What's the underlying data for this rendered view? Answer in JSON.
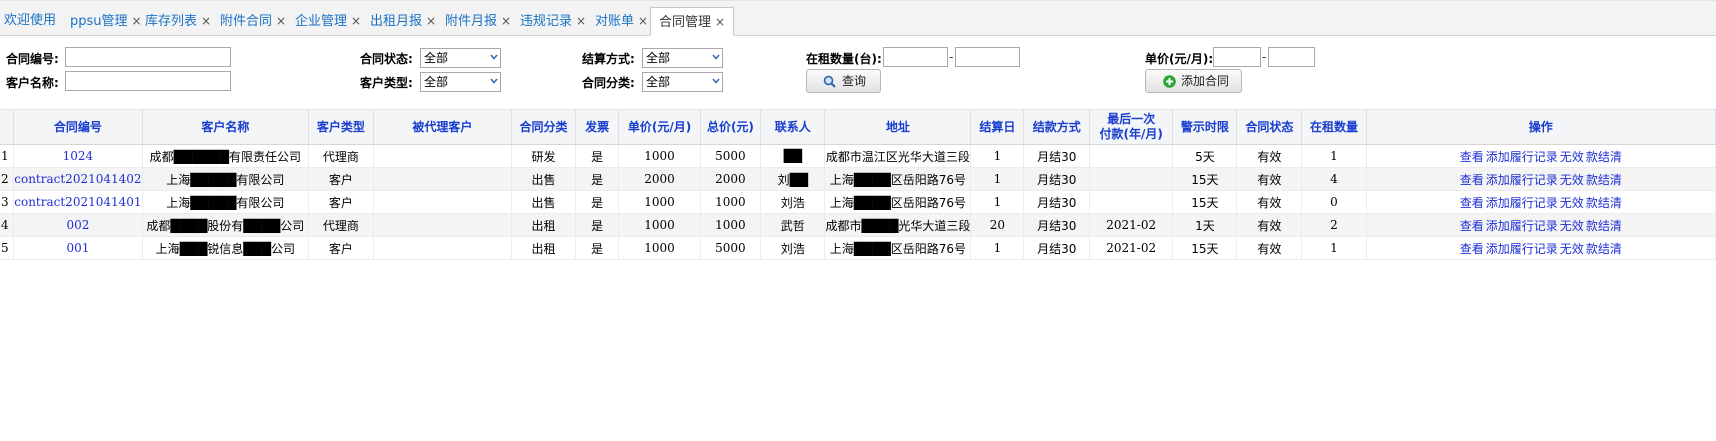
{
  "tabs": [
    {
      "label": "欢迎使用",
      "closable": false
    },
    {
      "label": "ppsu管理",
      "closable": true
    },
    {
      "label": "库存列表",
      "closable": true
    },
    {
      "label": "附件合同",
      "closable": true
    },
    {
      "label": "企业管理",
      "closable": true
    },
    {
      "label": "出租月报",
      "closable": true
    },
    {
      "label": "附件月报",
      "closable": true
    },
    {
      "label": "违规记录",
      "closable": true
    },
    {
      "label": "对账单",
      "closable": true
    },
    {
      "label": "合同管理",
      "closable": true,
      "active": true
    }
  ],
  "close_glyph": "×",
  "filters": {
    "contract_no_label": "合同编号:",
    "customer_name_label": "客户名称:",
    "contract_status_label": "合同状态:",
    "contract_status_value": "全部",
    "customer_type_label": "客户类型:",
    "customer_type_value": "全部",
    "settle_method_label": "结算方式:",
    "settle_method_value": "全部",
    "contract_category_label": "合同分类:",
    "contract_category_value": "全部",
    "rent_qty_label": "在租数量(台):",
    "unit_price_label": "单价(元/月):",
    "range_sep": "-",
    "query_button": "查询",
    "add_contract_button": "添加合同"
  },
  "table": {
    "headers": [
      "合同编号",
      "客户名称",
      "客户类型",
      "被代理客户",
      "合同分类",
      "发票",
      "单价(元/月)",
      "总价(元)",
      "联系人",
      "地址",
      "结算日",
      "结款方式",
      "最后一次\n付款(年/月)",
      "警示时限",
      "合同状态",
      "在租数量",
      "操作"
    ],
    "rows": [
      {
        "index": "1",
        "no": "1024",
        "customer": "成都██████有限责任公司",
        "type": "代理商",
        "proxy": "",
        "category": "研发",
        "invoice": "是",
        "unit": "1000",
        "total": "5000",
        "contact": "██",
        "address": "成都市温江区光华大道三段",
        "day": "1",
        "settle": "月结30",
        "last_pay": "",
        "warn": "5天",
        "status": "有效",
        "qty": "1"
      },
      {
        "index": "2",
        "no": "contract2021041402",
        "customer": "上海█████有限公司",
        "type": "客户",
        "proxy": "",
        "category": "出售",
        "invoice": "是",
        "unit": "2000",
        "total": "2000",
        "contact": "刘██",
        "address": "上海████区岳阳路76号",
        "day": "1",
        "settle": "月结30",
        "last_pay": "",
        "warn": "15天",
        "status": "有效",
        "qty": "4"
      },
      {
        "index": "3",
        "no": "contract2021041401",
        "customer": "上海█████有限公司",
        "type": "客户",
        "proxy": "",
        "category": "出售",
        "invoice": "是",
        "unit": "1000",
        "total": "1000",
        "contact": "刘浩",
        "address": "上海████区岳阳路76号",
        "day": "1",
        "settle": "月结30",
        "last_pay": "",
        "warn": "15天",
        "status": "有效",
        "qty": "0"
      },
      {
        "index": "4",
        "no": "002",
        "customer": "成都████股份有████公司",
        "type": "代理商",
        "proxy": "",
        "category": "出租",
        "invoice": "是",
        "unit": "1000",
        "total": "1000",
        "contact": "武哲",
        "address": "成都市████光华大道三段",
        "day": "20",
        "settle": "月结30",
        "last_pay": "2021-02",
        "warn": "1天",
        "status": "有效",
        "qty": "2"
      },
      {
        "index": "5",
        "no": "001",
        "customer": "上海███锐信息███公司",
        "type": "客户",
        "proxy": "",
        "category": "出租",
        "invoice": "是",
        "unit": "1000",
        "total": "5000",
        "contact": "刘浩",
        "address": "上海████区岳阳路76号",
        "day": "1",
        "settle": "月结30",
        "last_pay": "2021-02",
        "warn": "15天",
        "status": "有效",
        "qty": "1"
      }
    ],
    "actions": [
      "查看",
      "添加履行记录",
      "无效",
      "款结清"
    ]
  },
  "colors": {
    "link": "#1f2fd6",
    "tab_link": "#1a72c6",
    "header_text": "#1a3ecf",
    "add_icon": "#2fa53a"
  }
}
